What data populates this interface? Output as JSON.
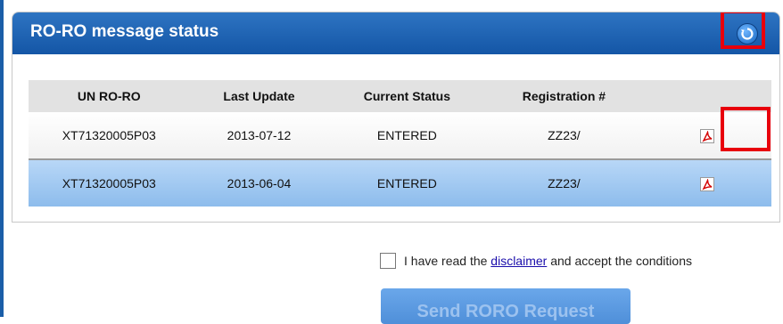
{
  "panel": {
    "title": "RO-RO message status"
  },
  "table": {
    "headers": [
      "UN RO-RO",
      "Last Update",
      "Current Status",
      "Registration #"
    ],
    "rows": [
      {
        "un": "XT71320005P03",
        "last_update": "2013-07-12",
        "status": "ENTERED",
        "registration": "ZZ23/"
      },
      {
        "un": "XT71320005P03",
        "last_update": "2013-06-04",
        "status": "ENTERED",
        "registration": "ZZ23/"
      }
    ]
  },
  "agreement": {
    "prefix": "I have read the ",
    "link": "disclaimer",
    "suffix": " and accept the conditions"
  },
  "send_button": "Send RORO Request",
  "colors": {
    "header_blue": "#1456a6",
    "selected_row": "#8dbcec",
    "highlight_red": "#e8000c"
  },
  "icons": [
    "refresh-icon",
    "pdf-icon"
  ]
}
